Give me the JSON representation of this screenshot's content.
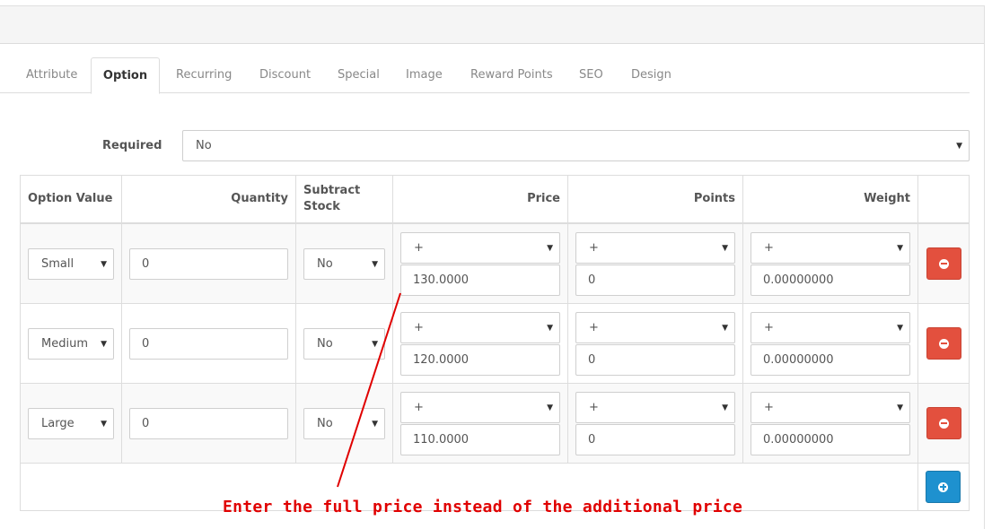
{
  "tabs": [
    "Attribute",
    "Option",
    "Recurring",
    "Discount",
    "Special",
    "Image",
    "Reward Points",
    "SEO",
    "Design"
  ],
  "active_tab": "Option",
  "required": {
    "label": "Required",
    "value": "No"
  },
  "table": {
    "headers": {
      "option_value": "Option Value",
      "quantity": "Quantity",
      "subtract_stock_1": "Subtract",
      "subtract_stock_2": "Stock",
      "price": "Price",
      "points": "Points",
      "weight": "Weight"
    },
    "rows": [
      {
        "option_value": "Small",
        "quantity": "0",
        "subtract": "No",
        "price_prefix": "+",
        "price": "130.0000",
        "points_prefix": "+",
        "points": "0",
        "weight_prefix": "+",
        "weight": "0.00000000"
      },
      {
        "option_value": "Medium",
        "quantity": "0",
        "subtract": "No",
        "price_prefix": "+",
        "price": "120.0000",
        "points_prefix": "+",
        "points": "0",
        "weight_prefix": "+",
        "weight": "0.00000000"
      },
      {
        "option_value": "Large",
        "quantity": "0",
        "subtract": "No",
        "price_prefix": "+",
        "price": "110.0000",
        "points_prefix": "+",
        "points": "0",
        "weight_prefix": "+",
        "weight": "0.00000000"
      }
    ]
  },
  "annotation": {
    "text": "Enter the full price instead of the additional price",
    "color": "#e00000"
  },
  "colors": {
    "danger": "#e3503e",
    "primary": "#1e91cf"
  },
  "icons": {
    "remove": "minus-circle-icon",
    "add": "plus-circle-icon",
    "dropdown": "caret-down-icon"
  }
}
